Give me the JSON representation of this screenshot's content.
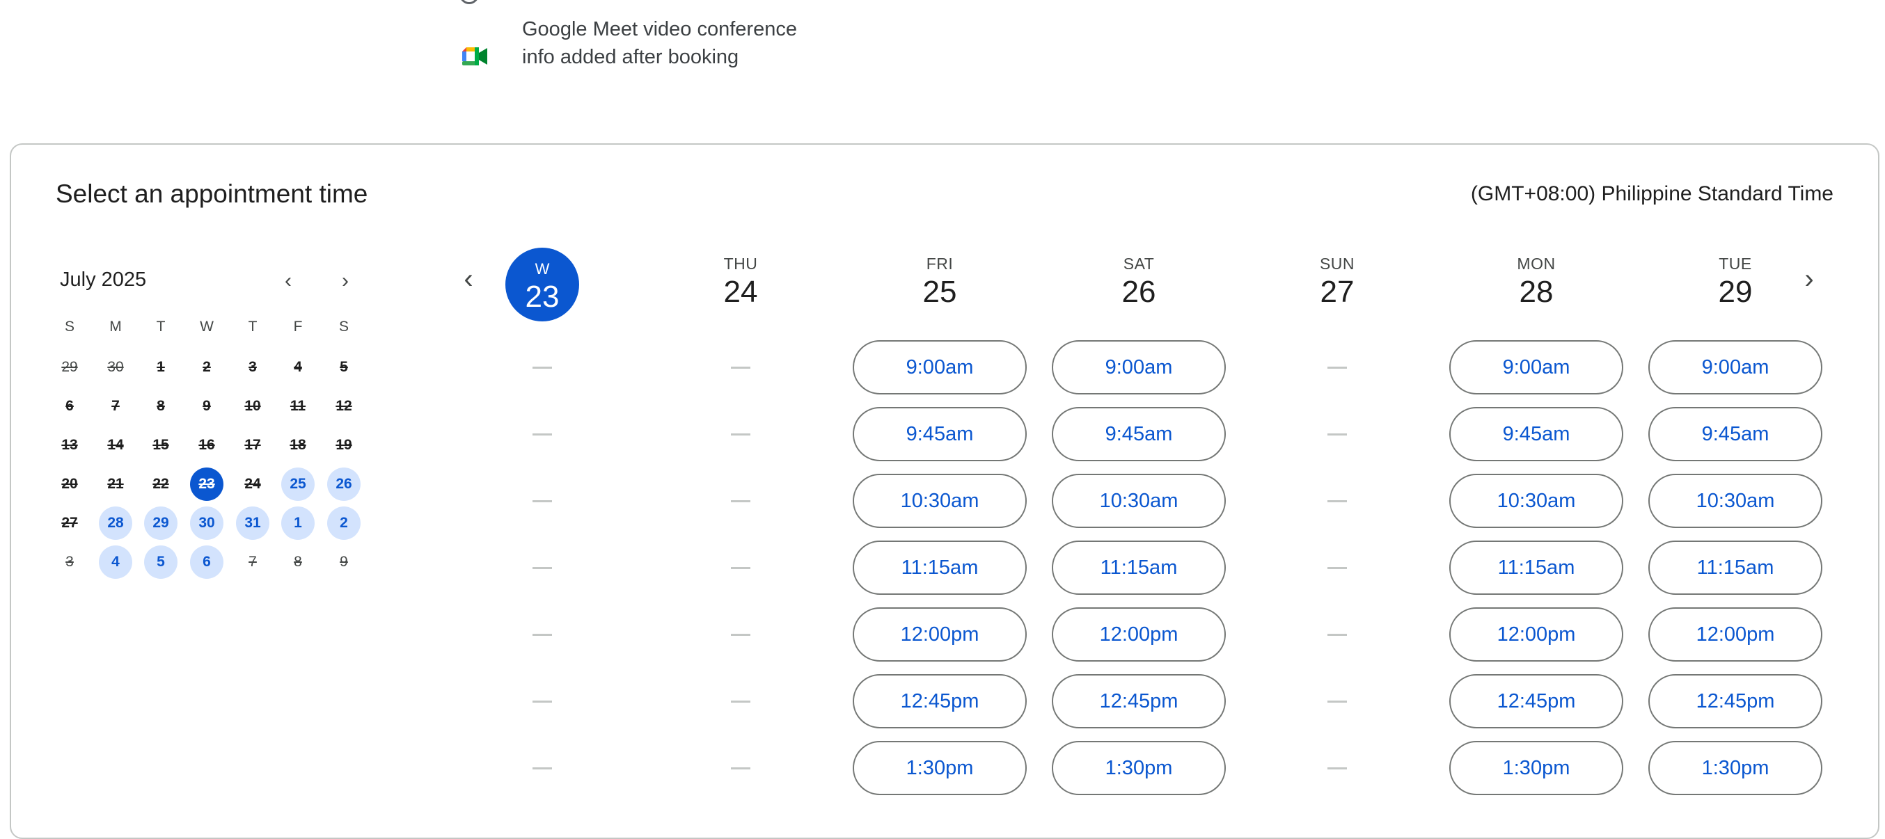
{
  "info": {
    "meet_text": "Google Meet video conference info added after booking",
    "meet_icon": "google-meet-icon"
  },
  "card": {
    "title": "Select an appointment time",
    "timezone": "(GMT+08:00) Philippine Standard Time"
  },
  "mini_calendar": {
    "month": "July 2025",
    "prev_icon": "chevron-left-icon",
    "next_icon": "chevron-right-icon",
    "days_of_week": [
      "S",
      "M",
      "T",
      "W",
      "T",
      "F",
      "S"
    ],
    "weeks": [
      [
        {
          "d": "29",
          "s": "unavail",
          "o": true
        },
        {
          "d": "30",
          "s": "unavail",
          "o": true
        },
        {
          "d": "1",
          "s": "unavail"
        },
        {
          "d": "2",
          "s": "unavail"
        },
        {
          "d": "3",
          "s": "unavail"
        },
        {
          "d": "4",
          "s": "unavail"
        },
        {
          "d": "5",
          "s": "unavail"
        }
      ],
      [
        {
          "d": "6",
          "s": "unavail"
        },
        {
          "d": "7",
          "s": "unavail"
        },
        {
          "d": "8",
          "s": "unavail"
        },
        {
          "d": "9",
          "s": "unavail"
        },
        {
          "d": "10",
          "s": "unavail"
        },
        {
          "d": "11",
          "s": "unavail"
        },
        {
          "d": "12",
          "s": "unavail"
        }
      ],
      [
        {
          "d": "13",
          "s": "unavail"
        },
        {
          "d": "14",
          "s": "unavail"
        },
        {
          "d": "15",
          "s": "unavail"
        },
        {
          "d": "16",
          "s": "unavail"
        },
        {
          "d": "17",
          "s": "unavail"
        },
        {
          "d": "18",
          "s": "unavail"
        },
        {
          "d": "19",
          "s": "unavail"
        }
      ],
      [
        {
          "d": "20",
          "s": "unavail"
        },
        {
          "d": "21",
          "s": "unavail"
        },
        {
          "d": "22",
          "s": "unavail"
        },
        {
          "d": "23",
          "s": "selected"
        },
        {
          "d": "24",
          "s": "unavail"
        },
        {
          "d": "25",
          "s": "avail"
        },
        {
          "d": "26",
          "s": "avail"
        }
      ],
      [
        {
          "d": "27",
          "s": "unavail"
        },
        {
          "d": "28",
          "s": "avail"
        },
        {
          "d": "29",
          "s": "avail"
        },
        {
          "d": "30",
          "s": "avail"
        },
        {
          "d": "31",
          "s": "avail"
        },
        {
          "d": "1",
          "s": "avail",
          "o": true
        },
        {
          "d": "2",
          "s": "avail",
          "o": true
        }
      ],
      [
        {
          "d": "3",
          "s": "unavail",
          "o": true
        },
        {
          "d": "4",
          "s": "avail",
          "o": true
        },
        {
          "d": "5",
          "s": "avail",
          "o": true
        },
        {
          "d": "6",
          "s": "avail",
          "o": true
        },
        {
          "d": "7",
          "s": "unavail",
          "o": true
        },
        {
          "d": "8",
          "s": "unavail",
          "o": true
        },
        {
          "d": "9",
          "s": "unavail",
          "o": true
        }
      ]
    ]
  },
  "week_view": {
    "prev_icon": "chevron-left-icon",
    "next_icon": "chevron-right-icon",
    "columns": [
      {
        "dow": "W",
        "date": "23",
        "active": true,
        "slots": []
      },
      {
        "dow": "THU",
        "date": "24",
        "slots": []
      },
      {
        "dow": "FRI",
        "date": "25",
        "slots": [
          "9:00am",
          "9:45am",
          "10:30am",
          "11:15am",
          "12:00pm",
          "12:45pm",
          "1:30pm"
        ]
      },
      {
        "dow": "SAT",
        "date": "26",
        "slots": [
          "9:00am",
          "9:45am",
          "10:30am",
          "11:15am",
          "12:00pm",
          "12:45pm",
          "1:30pm"
        ]
      },
      {
        "dow": "SUN",
        "date": "27",
        "slots": []
      },
      {
        "dow": "MON",
        "date": "28",
        "slots": [
          "9:00am",
          "9:45am",
          "10:30am",
          "11:15am",
          "12:00pm",
          "12:45pm",
          "1:30pm"
        ]
      },
      {
        "dow": "TUE",
        "date": "29",
        "slots": [
          "9:00am",
          "9:45am",
          "10:30am",
          "11:15am",
          "12:00pm",
          "12:45pm",
          "1:30pm"
        ]
      }
    ]
  },
  "colors": {
    "accent": "#0b57d0",
    "available_bg": "#d3e3fd",
    "border": "#747775"
  }
}
